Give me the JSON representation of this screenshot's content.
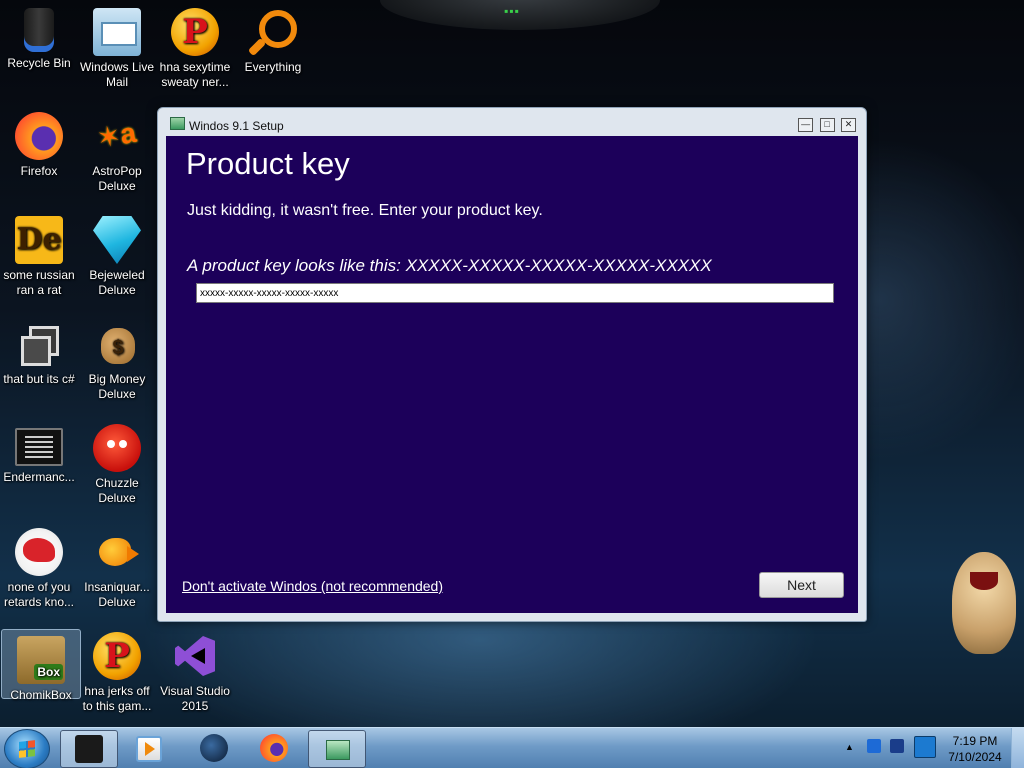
{
  "desktop": {
    "icons": [
      {
        "label": "Recycle Bin",
        "icon": "recycle-bin-icon"
      },
      {
        "label": "Windows Live Mail",
        "icon": "mail-icon"
      },
      {
        "label": "hna sexytime sweaty ner...",
        "icon": "popcap-p-icon"
      },
      {
        "label": "Everything",
        "icon": "magnifier-icon"
      },
      {
        "label": "Firefox",
        "icon": "firefox-icon"
      },
      {
        "label": "AstroPop Deluxe",
        "icon": "astropop-icon"
      },
      {
        "label": "some russian ran a rat",
        "icon": "de-icon"
      },
      {
        "label": "Bejeweled Deluxe",
        "icon": "gem-icon"
      },
      {
        "label": "that but its c#",
        "icon": "windows-stack-icon"
      },
      {
        "label": "Big Money Deluxe",
        "icon": "money-bag-icon"
      },
      {
        "label": "Endermanc...",
        "icon": "console-icon"
      },
      {
        "label": "Chuzzle Deluxe",
        "icon": "chuzzle-icon"
      },
      {
        "label": "none of you retards kno...",
        "icon": "dino-icon"
      },
      {
        "label": "Insaniquar... Deluxe",
        "icon": "fish-icon"
      },
      {
        "label": "ChomikBox",
        "icon": "chomikbox-icon"
      },
      {
        "label": "hna jerks off to this gam...",
        "icon": "popcap-p-icon"
      },
      {
        "label": "Visual Studio 2015",
        "icon": "visual-studio-icon"
      }
    ]
  },
  "window": {
    "title": "Windos 9.1 Setup",
    "controls": [
      "—",
      "□",
      "✕"
    ],
    "heading": "Product key",
    "subtitle": "Just kidding, it wasn't free. Enter your product key.",
    "hint": "A product key looks like this: XXXXX-XXXXX-XXXXX-XXXXX-XXXXX",
    "input_value": "xxxxx-xxxxx-xxxxx-xxxxx-xxxxx",
    "skip_link": "Don't activate Windos (not recommended)",
    "next_label": "Next",
    "body_color": "#1c005a"
  },
  "taskbar": {
    "time": "7:19 PM",
    "date": "7/10/2024",
    "tray_arrow": "▲"
  }
}
